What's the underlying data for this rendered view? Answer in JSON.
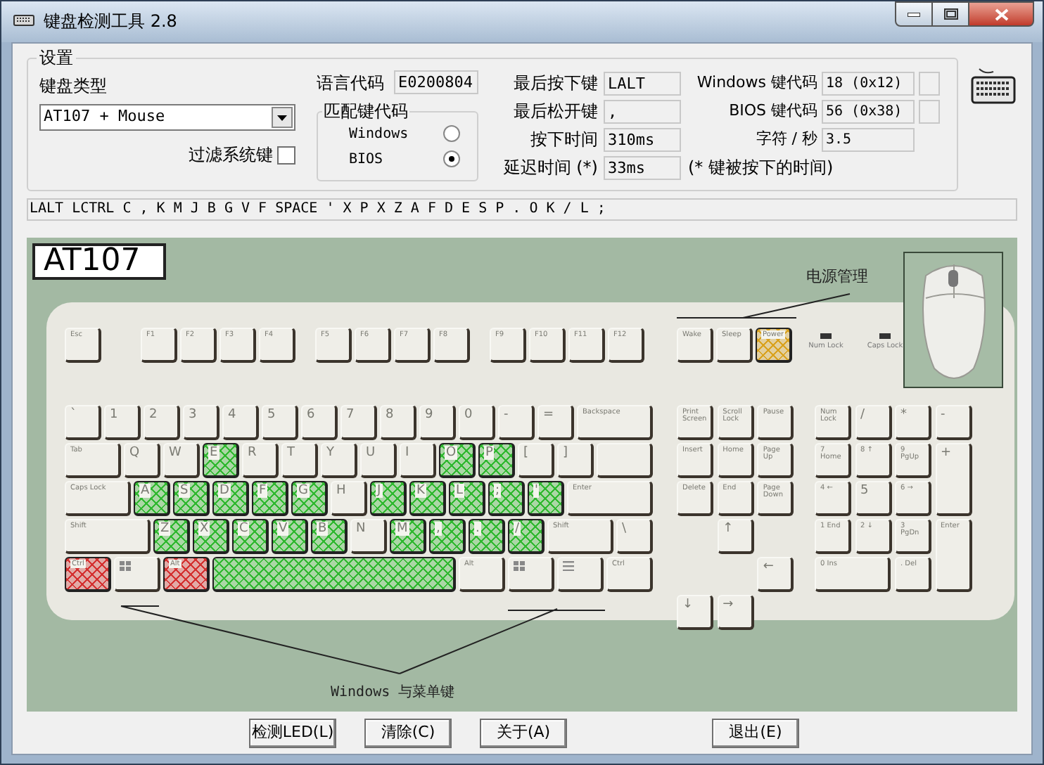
{
  "window": {
    "title": "键盘检测工具 2.8"
  },
  "settings": {
    "title": "设置",
    "keyboard_type": {
      "label": "键盘类型",
      "value": "AT107 + Mouse"
    },
    "filter_keys": {
      "label": "过滤系统键",
      "checked": false
    },
    "language_code": {
      "label": "语言代码",
      "value": "E0200804"
    },
    "match_code": {
      "title": "匹配键代码",
      "options": [
        {
          "label": "Windows",
          "selected": false
        },
        {
          "label": "BIOS",
          "selected": true
        }
      ]
    },
    "key_info": [
      {
        "label": "最后按下键",
        "value": "LALT"
      },
      {
        "label": "最后松开键",
        "value": ","
      },
      {
        "label": "按下时间",
        "value": "310ms"
      },
      {
        "label": "延迟时间 (*)",
        "value": "33ms"
      }
    ],
    "delay_note": "(* 键被按下的时间)",
    "codes": [
      {
        "label": "Windows 键代码",
        "value": "18 (0x12)",
        "indicator": true
      },
      {
        "label": "BIOS 键代码",
        "value": "56 (0x38)",
        "indicator": true
      },
      {
        "label": "字符 / 秒",
        "value": "3.5",
        "indicator": false
      }
    ]
  },
  "history": "LALT LCTRL C , K M J B G V F SPACE ' X P X Z A F D E S P . O K / L ;",
  "keyboard": {
    "model": "AT107",
    "function_keys": [
      {
        "label": "Esc"
      },
      {
        "label": "F1"
      },
      {
        "label": "F2"
      },
      {
        "label": "F3"
      },
      {
        "label": "F4"
      },
      {
        "label": "F5"
      },
      {
        "label": "F6"
      },
      {
        "label": "F7"
      },
      {
        "label": "F8"
      },
      {
        "label": "F9"
      },
      {
        "label": "F10"
      },
      {
        "label": "F11"
      },
      {
        "label": "F12"
      }
    ],
    "power_label": "电源管理",
    "power_keys": [
      {
        "label": "Wake"
      },
      {
        "label": "Sleep"
      },
      {
        "label": "Power",
        "color": "#d9a21e"
      }
    ],
    "leds": [
      {
        "label": "Num Lock"
      },
      {
        "label": "Caps Lock"
      }
    ],
    "main_rows": [
      [
        {
          "label": "`"
        },
        {
          "label": "1"
        },
        {
          "label": "2"
        },
        {
          "label": "3"
        },
        {
          "label": "4"
        },
        {
          "label": "5"
        },
        {
          "label": "6"
        },
        {
          "label": "7"
        },
        {
          "label": "8"
        },
        {
          "label": "9"
        },
        {
          "label": "0"
        },
        {
          "label": "-"
        },
        {
          "label": "="
        },
        {
          "label": "Backspace"
        }
      ],
      [
        {
          "label": "Tab"
        },
        {
          "label": "Q"
        },
        {
          "label": "W"
        },
        {
          "label": "E",
          "color": "#2fb82f"
        },
        {
          "label": "R"
        },
        {
          "label": "T"
        },
        {
          "label": "Y"
        },
        {
          "label": "U"
        },
        {
          "label": "I"
        },
        {
          "label": "O",
          "color": "#2fb82f"
        },
        {
          "label": "P",
          "color": "#2fb82f"
        },
        {
          "label": "["
        },
        {
          "label": "]"
        },
        {}
      ],
      [
        {
          "label": "Caps Lock"
        },
        {
          "label": "A",
          "color": "#2fb82f"
        },
        {
          "label": "S",
          "color": "#2fb82f"
        },
        {
          "label": "D",
          "color": "#2fb82f"
        },
        {
          "label": "F",
          "color": "#2fb82f"
        },
        {
          "label": "G",
          "color": "#2fb82f"
        },
        {
          "label": "H"
        },
        {
          "label": "J",
          "color": "#2fb82f"
        },
        {
          "label": "K",
          "color": "#2fb82f"
        },
        {
          "label": "L",
          "color": "#2fb82f"
        },
        {
          "label": ";",
          "color": "#2fb82f"
        },
        {
          "label": "'",
          "color": "#2fb82f"
        },
        {
          "label": "Enter"
        }
      ],
      [
        {
          "label": "Shift"
        },
        {
          "label": "Z",
          "color": "#2fb82f"
        },
        {
          "label": "X",
          "color": "#2fb82f"
        },
        {
          "label": "C",
          "color": "#2fb82f"
        },
        {
          "label": "V",
          "color": "#2fb82f"
        },
        {
          "label": "B",
          "color": "#2fb82f"
        },
        {
          "label": "N"
        },
        {
          "label": "M",
          "color": "#2fb82f"
        },
        {
          "label": ",",
          "color": "#2fb82f"
        },
        {
          "label": ".",
          "color": "#2fb82f"
        },
        {
          "label": "/",
          "color": "#2fb82f"
        },
        {
          "label": "Shift"
        },
        {
          "label": "\\"
        }
      ],
      [
        {
          "kind": "text",
          "label": "Ctrl",
          "color": "#d43030"
        },
        {
          "kind": "logo"
        },
        {
          "kind": "text",
          "label": "Alt",
          "color": "#d43030"
        },
        {
          "kind": "text",
          "color": "#2fb82f"
        },
        {
          "kind": "text",
          "label": "Alt"
        },
        {
          "kind": "logo"
        },
        {
          "kind": "menu"
        },
        {
          "kind": "text",
          "label": "Ctrl"
        }
      ]
    ],
    "nav_keys": [
      {
        "label": "Print Screen"
      },
      {
        "label": "Scroll Lock"
      },
      {
        "label": "Pause"
      },
      {
        "label": "Insert"
      },
      {
        "label": "Home"
      },
      {
        "label": "Page Up"
      },
      {
        "label": "Delete"
      },
      {
        "label": "End"
      },
      {
        "label": "Page Down"
      }
    ],
    "arrow_keys": [
      {
        "label": "↑"
      },
      {
        "label": "←"
      },
      {
        "label": "↓"
      },
      {
        "label": "→"
      }
    ],
    "numpad": [
      {
        "label": "Num Lock"
      },
      {
        "label": "/"
      },
      {
        "label": "*"
      },
      {
        "label": "-"
      },
      {
        "label": "7 Home"
      },
      {
        "label": "8 ↑"
      },
      {
        "label": "9 PgUp"
      },
      {
        "label": "+"
      },
      {
        "label": "4 ←"
      },
      {
        "label": "5"
      },
      {
        "label": "6 →"
      },
      {
        "label": "1 End"
      },
      {
        "label": "2 ↓"
      },
      {
        "label": "3 PgDn"
      },
      {
        "label": "Enter"
      },
      {
        "label": "0 Ins"
      },
      {
        "label": ". Del"
      }
    ],
    "windows_label": "Windows 与菜单键"
  },
  "buttons": [
    {
      "label": "检测LED(L)"
    },
    {
      "label": "清除(C)"
    },
    {
      "label": "关于(A)"
    },
    {
      "label": "退出(E)"
    }
  ]
}
